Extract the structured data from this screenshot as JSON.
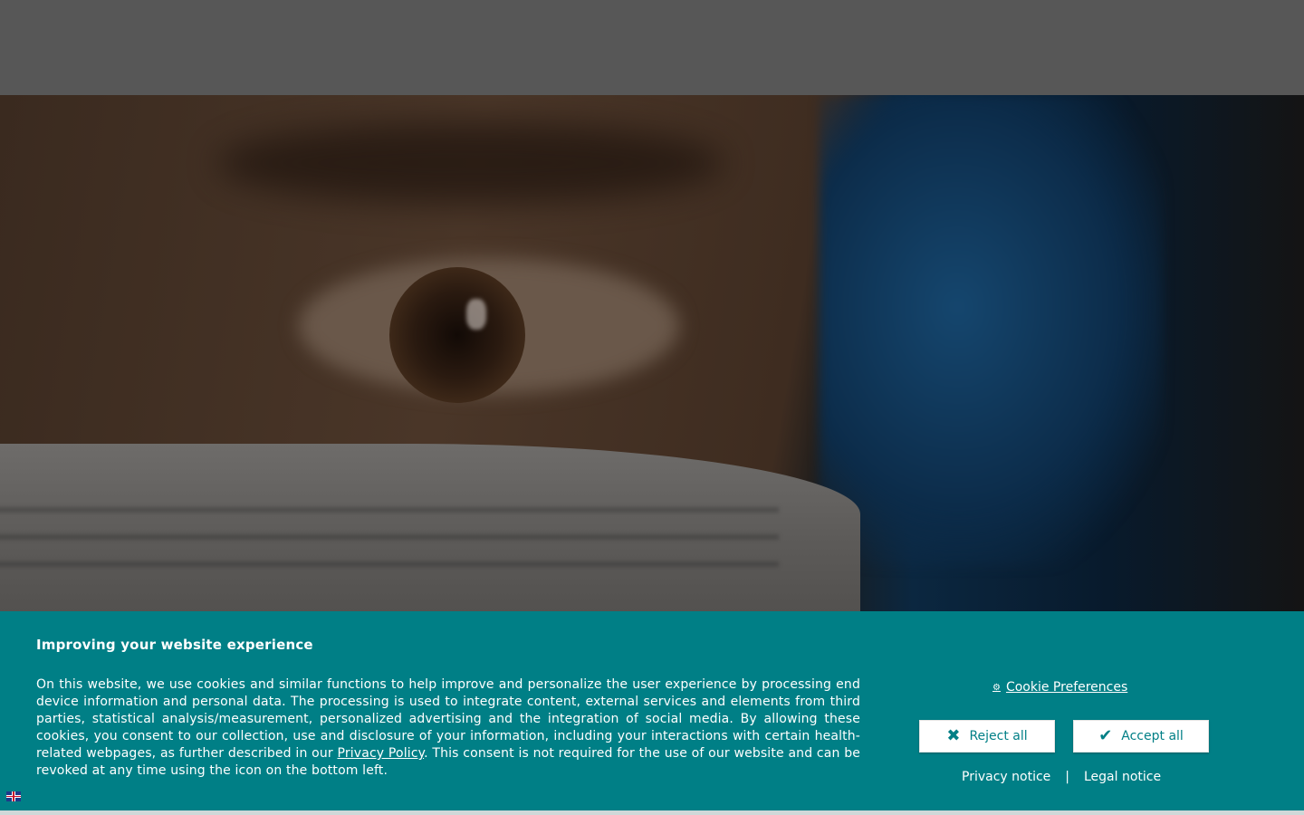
{
  "cookie_banner": {
    "title": "Improving your website experience",
    "text_before_link": "On this website, we use cookies and similar functions to help improve and personalize the user experience by processing end device information and personal data. The processing is used to integrate content, external services and elements from third parties, statistical analysis/measurement, personalized advertising and the integration of social media. By allowing these cookies, you consent to our collection, use and disclosure of your information, including your interactions with certain health-related webpages, as further described in our ",
    "privacy_policy_link": "Privacy Policy",
    "text_after_link": ". This consent is not required for the use of our website and can be revoked at any time using the icon on the bottom left.",
    "preferences_label": "Cookie Preferences",
    "reject_label": "Reject all",
    "accept_label": "Accept all",
    "privacy_notice_label": "Privacy notice",
    "separator": "|",
    "legal_notice_label": "Legal notice",
    "background_color": "#007f86",
    "button_text_color": "#007f86"
  },
  "icons": {
    "preferences": "gear-icon",
    "reject": "close-icon",
    "accept": "checkmark-icon",
    "language": "uk-flag-icon"
  }
}
